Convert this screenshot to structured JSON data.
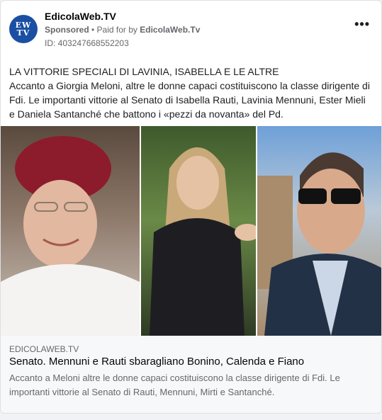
{
  "post": {
    "page_name": "EdicolaWeb.TV",
    "avatar_text": "EW TV",
    "sponsored_label": "Sponsored",
    "separator": " • ",
    "paid_for_prefix": "Paid for by ",
    "paid_for_name": "EdicolaWeb.Tv",
    "ad_id": "ID: 403247668552203",
    "more_label": "•••",
    "body_title": "LA VITTORIE SPECIALI DI LAVINIA, ISABELLA E LE ALTRE",
    "body_text": "Accanto a Giorgia Meloni, altre le donne capaci costituiscono la classe dirigente di Fdi. Le importanti vittorie al Senato di Isabella Rauti, Lavinia Mennuni, Ester Mieli e Daniela Santanché che battono i «pezzi da novanta» del Pd."
  },
  "link": {
    "domain": "EDICOLAWEB.TV",
    "headline": "Senato. Mennuni e Rauti sbaragliano Bonino, Calenda e Fiano",
    "description": "Accanto a Meloni altre le donne capaci costituiscono la classe dirigente di Fdi. Le importanti vittorie al Senato di Rauti, Mennuni, Mirti e Santanché."
  },
  "colors": {
    "avatar_bg": "#1a4fa3",
    "secondary_text": "#65676b",
    "link_bg": "#f7f8fa"
  }
}
